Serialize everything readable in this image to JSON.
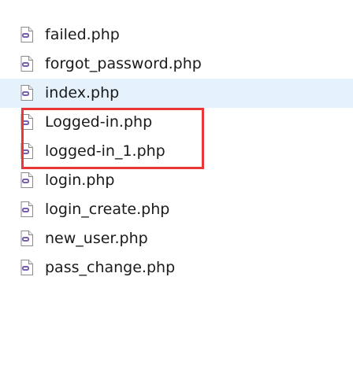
{
  "files": [
    {
      "name": "failed.php",
      "icon": "php-file-icon",
      "hovered": false
    },
    {
      "name": "forgot_password.php",
      "icon": "php-file-icon",
      "hovered": false
    },
    {
      "name": "index.php",
      "icon": "php-file-icon",
      "hovered": true
    },
    {
      "name": "Logged-in.php",
      "icon": "php-file-icon",
      "hovered": false
    },
    {
      "name": "logged-in_1.php",
      "icon": "php-file-icon",
      "hovered": false
    },
    {
      "name": "login.php",
      "icon": "php-file-icon",
      "hovered": false
    },
    {
      "name": "login_create.php",
      "icon": "php-file-icon",
      "hovered": false
    },
    {
      "name": "new_user.php",
      "icon": "php-file-icon",
      "hovered": false
    },
    {
      "name": "pass_change.php",
      "icon": "php-file-icon",
      "hovered": false
    }
  ],
  "colors": {
    "hover_background": "#e5f1fb",
    "highlight_border": "#e8383a",
    "php_badge": "#7a5fb4"
  }
}
